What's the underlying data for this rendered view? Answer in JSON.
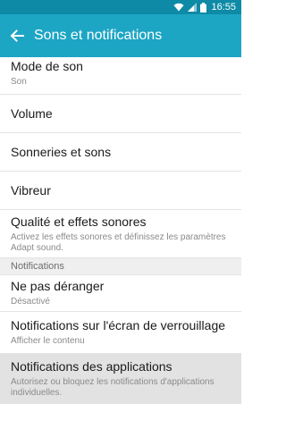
{
  "status_bar": {
    "time": "16:55",
    "icons": [
      "wifi-icon",
      "signal-icon",
      "battery-icon"
    ]
  },
  "app_bar": {
    "back_icon": "arrow-left-icon",
    "title": "Sons et notifications"
  },
  "colors": {
    "status_bar": "#0e8aa6",
    "app_bar": "#1da5c4",
    "section_header_bg": "#efefef",
    "highlighted_item_bg": "#e2e2e2"
  },
  "settings": {
    "mode": {
      "label": "Mode de son",
      "value": "Son"
    },
    "volume": {
      "label": "Volume"
    },
    "ringtones": {
      "label": "Sonneries et sons"
    },
    "vibration": {
      "label": "Vibreur"
    },
    "quality": {
      "label": "Qualité et effets sonores",
      "description": "Activez les effets sonores et définissez les paramètres Adapt sound."
    }
  },
  "notifications_section": {
    "header": "Notifications",
    "dnd": {
      "label": "Ne pas déranger",
      "value": "Désactivé"
    },
    "lockscreen": {
      "label": "Notifications sur l'écran de verrouillage",
      "value": "Afficher le contenu"
    },
    "apps": {
      "label": "Notifications des applications",
      "description": "Autorisez ou bloquez les notifications d'applications individuelles."
    }
  }
}
